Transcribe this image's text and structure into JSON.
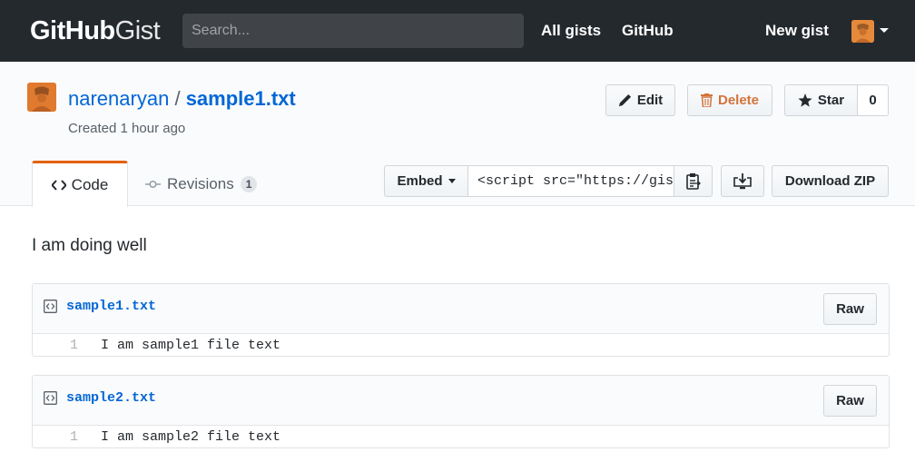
{
  "header": {
    "logo_bold": "GitHub",
    "logo_light": "Gist",
    "search_placeholder": "Search...",
    "nav": [
      "All gists",
      "GitHub"
    ],
    "new_gist": "New gist"
  },
  "gist": {
    "owner": "narenaryan",
    "separator": "/",
    "filename": "sample1.txt",
    "created": "Created 1 hour ago",
    "description": "I am doing well"
  },
  "actions": {
    "edit": "Edit",
    "delete": "Delete",
    "star": "Star",
    "star_count": "0"
  },
  "tabs": {
    "code": "Code",
    "revisions": "Revisions",
    "revisions_count": "1"
  },
  "embed": {
    "label": "Embed",
    "value": "<script src=\"https://gist.github.com/narenaryan",
    "download_zip": "Download ZIP"
  },
  "files": [
    {
      "name": "sample1.txt",
      "raw": "Raw",
      "lines": [
        {
          "num": "1",
          "text": "I am sample1 file text"
        }
      ]
    },
    {
      "name": "sample2.txt",
      "raw": "Raw",
      "lines": [
        {
          "num": "1",
          "text": "I am sample2 file text"
        }
      ]
    }
  ],
  "colors": {
    "header_bg": "#24292e",
    "link": "#0366d6",
    "tab_accent": "#e36209",
    "delete_text": "#d4733a"
  }
}
